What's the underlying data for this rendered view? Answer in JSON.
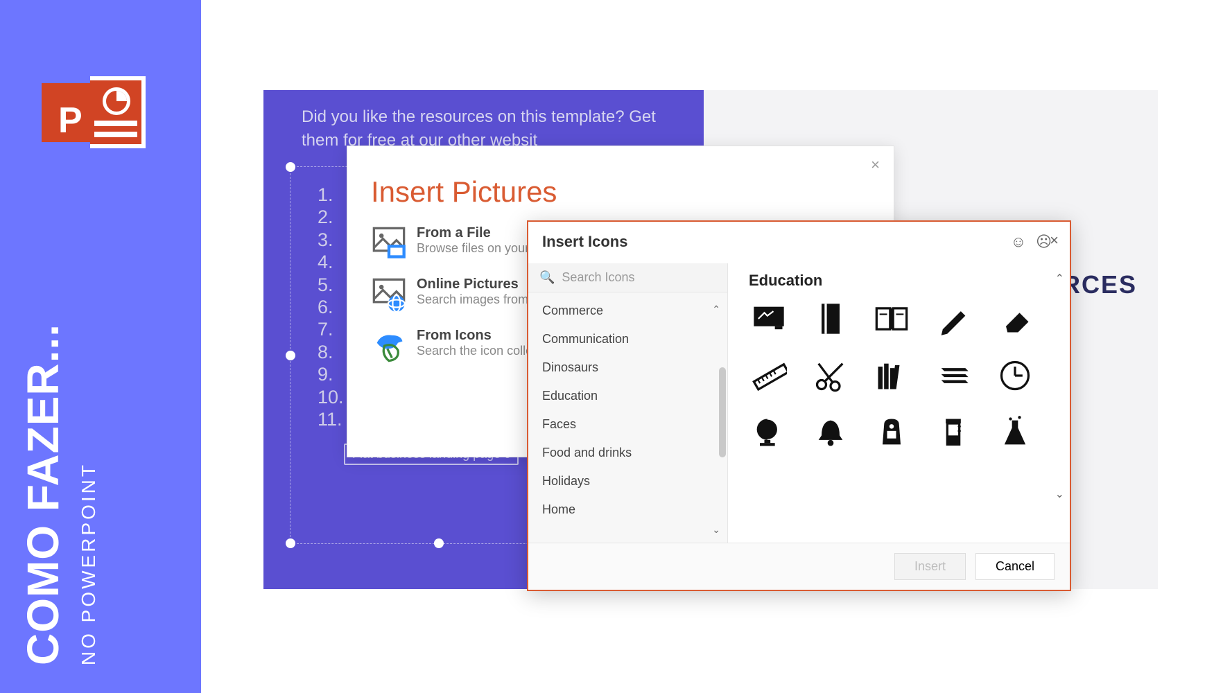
{
  "sidebar": {
    "title": "COMO FAZER...",
    "subtitle": "NO POWERPOINT"
  },
  "slide": {
    "intro": "Did you like the resources on this template? Get them for free at our other websit",
    "chip": "Flat business landing page c",
    "big_title_fragment": "JRCES",
    "numbers": [
      "1.",
      "2.",
      "3.",
      "4.",
      "5.",
      "6.",
      "7.",
      "8.",
      "9.",
      "10.",
      "11."
    ]
  },
  "dialog1": {
    "title": "Insert Pictures",
    "opts": [
      {
        "title": "From a File",
        "sub": "Browse files on your c"
      },
      {
        "title": "Online Pictures",
        "sub": "Search images from o"
      },
      {
        "title": "From Icons",
        "sub": "Search the icon collec"
      }
    ],
    "close": "×"
  },
  "dialog2": {
    "title": "Insert Icons",
    "close": "×",
    "search_placeholder": "Search Icons",
    "categories": [
      "Commerce",
      "Communication",
      "Dinosaurs",
      "Education",
      "Faces",
      "Food and drinks",
      "Holidays",
      "Home"
    ],
    "selected_category": "Education",
    "icons": [
      "chalkboard",
      "notebook",
      "open-book",
      "pencil",
      "eraser",
      "ruler",
      "scissors",
      "library-books",
      "stacked-books",
      "clock",
      "globe",
      "bell",
      "backpack",
      "beaker",
      "flask"
    ],
    "buttons": {
      "insert": "Insert",
      "cancel": "Cancel"
    }
  }
}
